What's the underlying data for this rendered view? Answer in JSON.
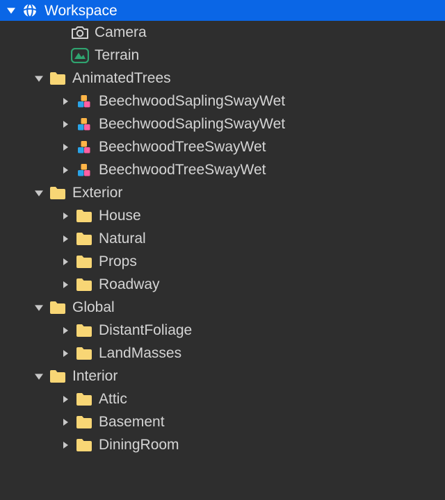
{
  "colors": {
    "selection": "#0a66e6",
    "folder": "#f8d675",
    "terrain": "#2fa36f",
    "model_blue": "#2aa4e8",
    "model_orange": "#ffb547",
    "model_pink": "#ff5fa2",
    "text": "#d4d4d4",
    "rootText": "#ffffff"
  },
  "root": {
    "label": "Workspace"
  },
  "items": [
    {
      "label": "Camera",
      "icon": "camera",
      "depth": 1,
      "arrow": "none"
    },
    {
      "label": "Terrain",
      "icon": "terrain",
      "depth": 1,
      "arrow": "none"
    },
    {
      "label": "AnimatedTrees",
      "icon": "folder",
      "depth": 2,
      "arrow": "open"
    },
    {
      "label": "BeechwoodSaplingSwayWet",
      "icon": "model",
      "depth": 3,
      "arrow": "closed"
    },
    {
      "label": "BeechwoodSaplingSwayWet",
      "icon": "model",
      "depth": 3,
      "arrow": "closed"
    },
    {
      "label": "BeechwoodTreeSwayWet",
      "icon": "model",
      "depth": 3,
      "arrow": "closed"
    },
    {
      "label": "BeechwoodTreeSwayWet",
      "icon": "model",
      "depth": 3,
      "arrow": "closed"
    },
    {
      "label": "Exterior",
      "icon": "folder",
      "depth": 2,
      "arrow": "open"
    },
    {
      "label": "House",
      "icon": "folder",
      "depth": 3,
      "arrow": "closed"
    },
    {
      "label": "Natural",
      "icon": "folder",
      "depth": 3,
      "arrow": "closed"
    },
    {
      "label": "Props",
      "icon": "folder",
      "depth": 3,
      "arrow": "closed"
    },
    {
      "label": "Roadway",
      "icon": "folder",
      "depth": 3,
      "arrow": "closed"
    },
    {
      "label": "Global",
      "icon": "folder",
      "depth": 2,
      "arrow": "open"
    },
    {
      "label": "DistantFoliage",
      "icon": "folder",
      "depth": 3,
      "arrow": "closed"
    },
    {
      "label": "LandMasses",
      "icon": "folder",
      "depth": 3,
      "arrow": "closed"
    },
    {
      "label": "Interior",
      "icon": "folder",
      "depth": 2,
      "arrow": "open"
    },
    {
      "label": "Attic",
      "icon": "folder",
      "depth": 3,
      "arrow": "closed"
    },
    {
      "label": "Basement",
      "icon": "folder",
      "depth": 3,
      "arrow": "closed"
    },
    {
      "label": "DiningRoom",
      "icon": "folder",
      "depth": 3,
      "arrow": "closed"
    }
  ]
}
